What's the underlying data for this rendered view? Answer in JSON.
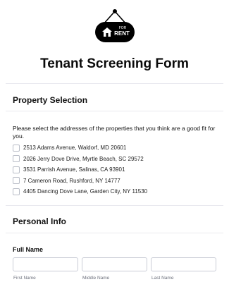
{
  "logo": {
    "icon": "for-rent-sign-icon",
    "small_text": "FOR",
    "big_text": "RENT"
  },
  "form": {
    "title": "Tenant Screening Form"
  },
  "property_section": {
    "title": "Property Selection",
    "question": "Please select the addresses of the properties that you think are a good fit for you.",
    "options": [
      {
        "label": "2513 Adams Avenue, Waldorf, MD 20601",
        "checked": false
      },
      {
        "label": "2026 Jerry Dove Drive, Myrtle Beach, SC 29572",
        "checked": false
      },
      {
        "label": "3531 Parrish Avenue, Salinas, CA 93901",
        "checked": false
      },
      {
        "label": "7 Cameron Road, Rushford, NY 14777",
        "checked": false
      },
      {
        "label": "4405 Dancing Dove Lane, Garden City, NY 11530",
        "checked": false
      }
    ]
  },
  "personal_section": {
    "title": "Personal Info",
    "full_name": {
      "label": "Full Name",
      "first_label": "First Name",
      "middle_label": "Middle Name",
      "last_label": "Last Name",
      "first_value": "",
      "middle_value": "",
      "last_value": ""
    }
  }
}
